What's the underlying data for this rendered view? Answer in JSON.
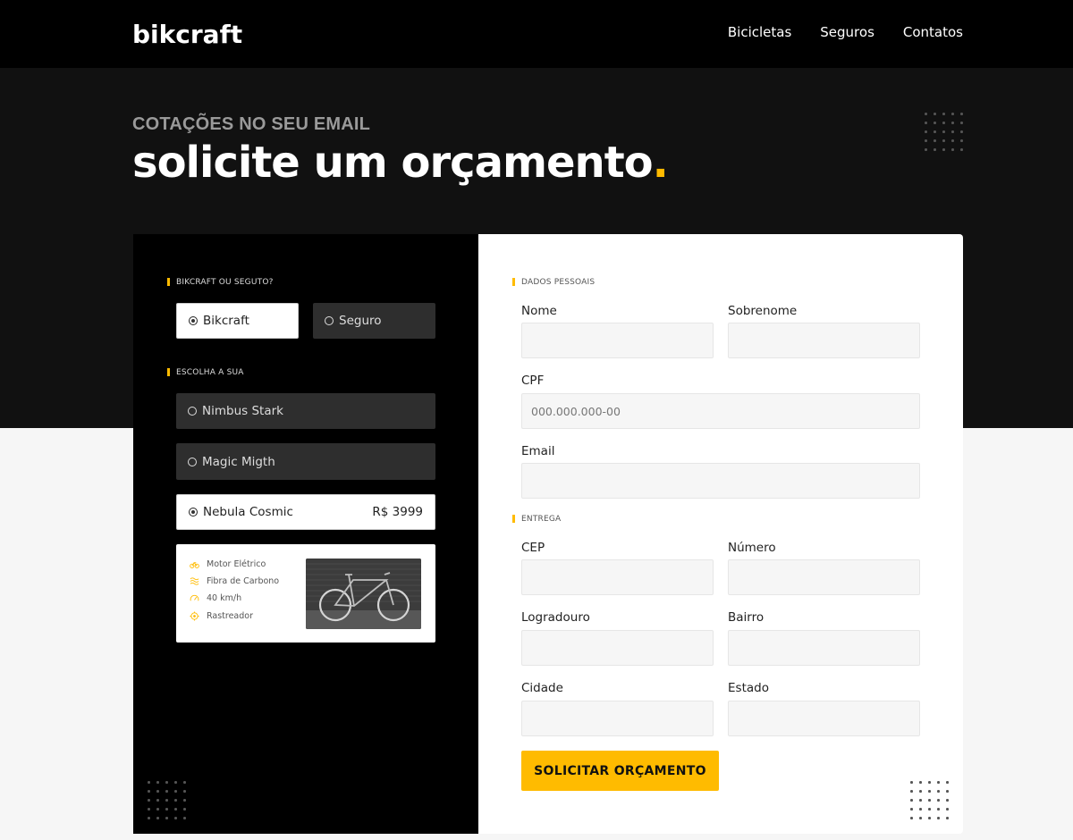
{
  "header": {
    "logo": "bikcraft",
    "nav": [
      "Bicicletas",
      "Seguros",
      "Contatos"
    ]
  },
  "hero": {
    "subtitle": "COTAÇÕES NO SEU EMAIL",
    "title": "solicite um orçamento",
    "title_dot": "."
  },
  "left": {
    "section1_label": "BIKCRAFT OU SEGUTO?",
    "type_options": [
      {
        "label": "Bikcraft",
        "selected": true
      },
      {
        "label": "Seguro",
        "selected": false
      }
    ],
    "section2_label": "ESCOLHA A SUA",
    "bikes": [
      {
        "label": "Nimbus Stark",
        "selected": false
      },
      {
        "label": "Magic Migth",
        "selected": false
      },
      {
        "label": "Nebula Cosmic",
        "selected": true,
        "price": "R$ 3999"
      }
    ],
    "specs": [
      {
        "icon": "motor-icon",
        "label": "Motor Elétrico"
      },
      {
        "icon": "carbon-icon",
        "label": "Fibra de Carbono"
      },
      {
        "icon": "speed-icon",
        "label": "40 km/h"
      },
      {
        "icon": "tracker-icon",
        "label": "Rastreador"
      }
    ]
  },
  "form": {
    "personal_label": "DADOS PESSOAIS",
    "nome_label": "Nome",
    "sobrenome_label": "Sobrenome",
    "cpf_label": "CPF",
    "cpf_placeholder": "000.000.000-00",
    "email_label": "Email",
    "delivery_label": "ENTREGA",
    "cep_label": "CEP",
    "numero_label": "Número",
    "logradouro_label": "Logradouro",
    "bairro_label": "Bairro",
    "cidade_label": "Cidade",
    "estado_label": "Estado",
    "submit_label": "SOLICITAR ORÇAMENTO"
  },
  "colors": {
    "accent": "#ffbb00",
    "header_bg": "#000000",
    "hero_bg": "#111111"
  }
}
